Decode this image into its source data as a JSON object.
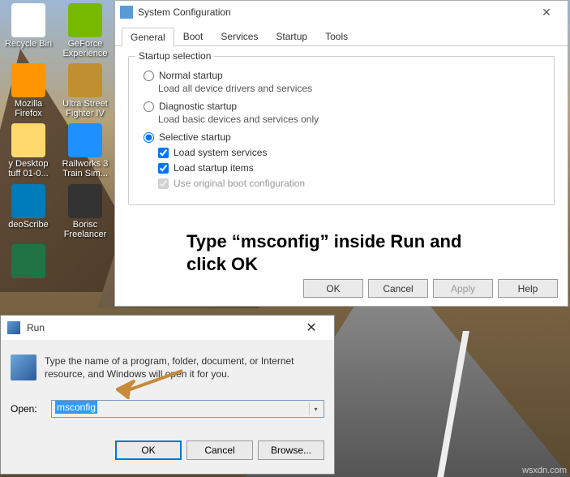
{
  "desktop": {
    "icons": [
      {
        "label": "Recycle Bin",
        "cls": "ico-recycle"
      },
      {
        "label": "GeForce Experience",
        "cls": "ico-geforce"
      },
      {
        "label": "Mozilla Firefox",
        "cls": "ico-firefox"
      },
      {
        "label": "Ultra Street Fighter IV",
        "cls": "ico-sf"
      },
      {
        "label": "y Desktop tuff 01-0...",
        "cls": "ico-folder"
      },
      {
        "label": "Railworks 3 Train Sim...",
        "cls": "ico-train"
      },
      {
        "label": "deoScribe",
        "cls": "ico-vscribe"
      },
      {
        "label": "Borisc Freelancer",
        "cls": "ico-borisc"
      },
      {
        "label": "",
        "cls": "ico-excel"
      }
    ]
  },
  "syscfg": {
    "title": "System Configuration",
    "tabs": [
      "General",
      "Boot",
      "Services",
      "Startup",
      "Tools"
    ],
    "group_title": "Startup selection",
    "opt1": "Normal startup",
    "opt1_desc": "Load all device drivers and services",
    "opt2": "Diagnostic startup",
    "opt2_desc": "Load basic devices and services only",
    "opt3": "Selective startup",
    "chk1": "Load system services",
    "chk2": "Load startup items",
    "chk3": "Use original boot configuration",
    "btn_ok": "OK",
    "btn_cancel": "Cancel",
    "btn_apply": "Apply",
    "btn_help": "Help"
  },
  "annotation": "Type “msconfig” inside Run and click OK",
  "run": {
    "title": "Run",
    "help": "Type the name of a program, folder, document, or Internet resource, and Windows will open it for you.",
    "open_label": "Open:",
    "value": "msconfig",
    "btn_ok": "OK",
    "btn_cancel": "Cancel",
    "btn_browse": "Browse..."
  },
  "watermark": "wsxdn.com"
}
